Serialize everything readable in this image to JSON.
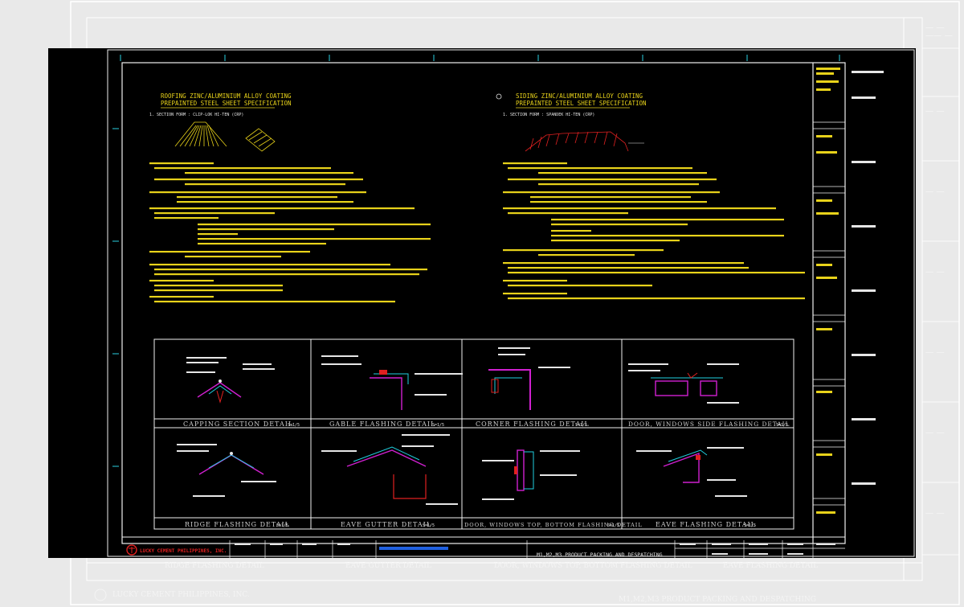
{
  "left_spec": {
    "title_line1": "ROOFING ZINC/ALUMINIUM ALLOY COATING",
    "title_line2": "PREPAINTED STEEL SHEET SPECIFICATION",
    "section_form": "1. SECTION FORM : CLIP-LOK HI-TEN (CRP)"
  },
  "right_spec": {
    "title_line1": "SIDING ZINC/ALUMINIUM ALLOY COATING",
    "title_line2": "PREPAINTED STEEL SHEET SPECIFICATION",
    "section_form": "1. SECTION FORM : SPANDEK HI-TEN (CRP)"
  },
  "details": {
    "row1": [
      {
        "caption": "CAPPING SECTION DETAIL",
        "scale": "S=1/5"
      },
      {
        "caption": "GABLE FLASHING DETAIL",
        "scale": "S=1/5"
      },
      {
        "caption": "CORNER FLASHING DETAIL",
        "scale": "S=1/5"
      },
      {
        "caption": "DOOR, WINDOWS SIDE FLASHING DETAIL",
        "scale": "S=1/5"
      }
    ],
    "row2": [
      {
        "caption": "RIDGE FLASHING DETAIL",
        "scale": "S=1/5"
      },
      {
        "caption": "EAVE GUTTER DETAIL",
        "scale": "S=1/5"
      },
      {
        "caption": "DOOR, WINDOWS TOP, BOTTOM FLASHING DETAIL",
        "scale": "S=1/5"
      },
      {
        "caption": "EAVE FLASHING DETAIL",
        "scale": "S=1/5"
      }
    ]
  },
  "title_block": {
    "company": "LUCKY CEMENT PHILIPPINES, INC.",
    "drawing_title": "M1,M2,M3 PRODUCT PACKING AND DESPATCHING"
  },
  "colors": {
    "background": "#000000",
    "spec_text": "#e8d21a",
    "annotation": "#e6e6e6",
    "detail_magenta": "#d020d0",
    "detail_cyan": "#20d0e0",
    "detail_red": "#e02020",
    "frame": "#f0f0f0"
  }
}
